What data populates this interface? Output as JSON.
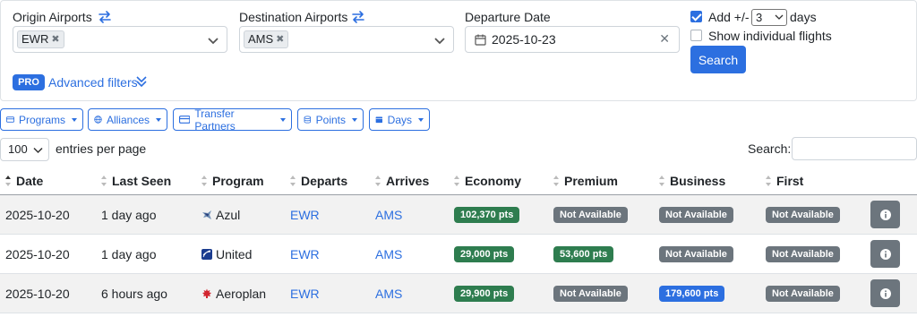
{
  "search": {
    "origin_label": "Origin Airports",
    "origin_value": "EWR",
    "destination_label": "Destination Airports",
    "destination_value": "AMS",
    "departure_label": "Departure Date",
    "departure_value": "2025-10-23",
    "add_label": "Add +/-",
    "add_days_value": "3",
    "days_label": "days",
    "add_checked": true,
    "show_individual_label": "Show individual flights",
    "show_individual_checked": false,
    "search_button": "Search",
    "pro_badge": "PRO",
    "advanced_filters": "Advanced filters"
  },
  "filters": [
    "Programs",
    "Alliances",
    "Transfer Partners",
    "Points",
    "Days"
  ],
  "table_controls": {
    "page_length": "100",
    "entries_label": "entries per page",
    "search_label": "Search:"
  },
  "columns": [
    "Date",
    "Last Seen",
    "Program",
    "Departs",
    "Arrives",
    "Economy",
    "Premium",
    "Business",
    "First"
  ],
  "rows": [
    {
      "date": "2025-10-20",
      "last_seen": "1 day ago",
      "program": "Azul",
      "departs": "EWR",
      "arrives": "AMS",
      "economy": "102,370 pts",
      "premium": "Not Available",
      "business": "Not Available",
      "first": "Not Available"
    },
    {
      "date": "2025-10-20",
      "last_seen": "1 day ago",
      "program": "United",
      "departs": "EWR",
      "arrives": "AMS",
      "economy": "29,000 pts",
      "premium": "53,600 pts",
      "business": "Not Available",
      "first": "Not Available"
    },
    {
      "date": "2025-10-20",
      "last_seen": "6 hours ago",
      "program": "Aeroplan",
      "departs": "EWR",
      "arrives": "AMS",
      "economy": "29,900 pts",
      "premium": "Not Available",
      "business": "179,600 pts",
      "first": "Not Available"
    }
  ],
  "colors": {
    "primary": "#2c6fe0",
    "available_green": "#2e7d4f",
    "business_blue": "#2c6fe0",
    "not_available_gray": "#6c757d"
  }
}
